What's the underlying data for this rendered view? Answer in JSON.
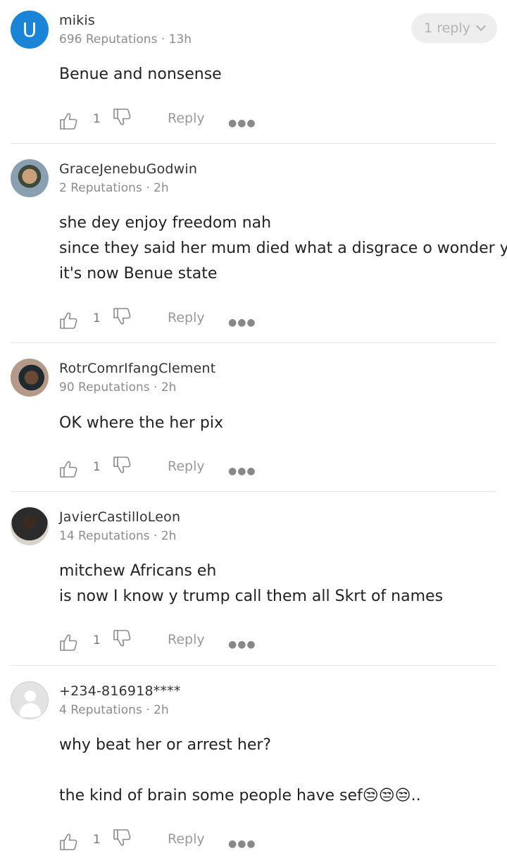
{
  "comments": [
    {
      "avatar_letter": "U",
      "username": "mikis",
      "meta": "696 Reputations · 13h",
      "replies_label": "1 reply",
      "lines": [
        "Benue and nonsense"
      ],
      "like_count": "1",
      "reply_label": "Reply"
    },
    {
      "username": "GraceJenebuGodwin",
      "meta": "2 Reputations · 2h",
      "lines": [
        "she dey enjoy freedom nah",
        "since they said her mum died what a disgrace o wonder y",
        "it's now Benue state"
      ],
      "like_count": "1",
      "reply_label": "Reply"
    },
    {
      "username": "RotrComrIfangClement",
      "meta": "90 Reputations · 2h",
      "lines": [
        "OK where the her pix"
      ],
      "like_count": "1",
      "reply_label": "Reply"
    },
    {
      "username": "JavierCastilloLeon",
      "meta": "14 Reputations · 2h",
      "lines": [
        "mitchew Africans eh",
        "is now I know y trump call them all Skrt of names"
      ],
      "like_count": "1",
      "reply_label": "Reply"
    },
    {
      "username": "+234-816918****",
      "meta": "4 Reputations · 2h",
      "lines": [
        "why beat her or arrest her?",
        "",
        "the kind of brain some people have sef"
      ],
      "emoji": "😒😒😒",
      "trailing": "..",
      "like_count": "1",
      "reply_label": "Reply"
    }
  ],
  "icons": {
    "like": "thumbs-up-icon",
    "dislike": "thumbs-down-icon",
    "more": "more-options-icon",
    "chevron": "chevron-down-icon"
  },
  "colors": {
    "avatar_letter_bg": "#1a84d6",
    "divider": "#e4e4e4"
  }
}
